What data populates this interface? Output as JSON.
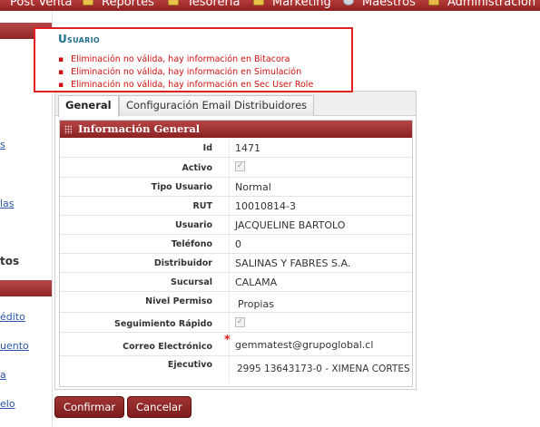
{
  "menu": {
    "items": [
      {
        "label": "Post Venta",
        "icon": "none"
      },
      {
        "label": "Reportes",
        "icon": "folder-icon"
      },
      {
        "label": "Tesorería",
        "icon": "folder-icon"
      },
      {
        "label": "Marketing",
        "icon": "folder-icon"
      },
      {
        "label": "Maestros",
        "icon": "database-icon"
      },
      {
        "label": "Administración",
        "icon": "people-icon"
      }
    ]
  },
  "sidebar": {
    "fragments": [
      "s",
      "las",
      "tos",
      "édito",
      "uento",
      "a",
      "elo"
    ]
  },
  "error_box": {
    "title": "Usuario",
    "messages": [
      "Eliminación no válida, hay información en Bitacora",
      "Eliminación no válida, hay información en Simulación",
      "Eliminación no válida, hay información en Sec User Role"
    ]
  },
  "tabs": [
    {
      "label": "General",
      "active": true
    },
    {
      "label": "Configuración Email Distribuidores",
      "active": false
    }
  ],
  "panel": {
    "title": "Información General",
    "fields": {
      "id": {
        "label": "Id",
        "value": "1471"
      },
      "activo": {
        "label": "Activo",
        "checked": true
      },
      "tipo_usuario": {
        "label": "Tipo Usuario",
        "value": "Normal"
      },
      "rut": {
        "label": "RUT",
        "value": "10010814-3"
      },
      "usuario": {
        "label": "Usuario",
        "value": "JACQUELINE BARTOLO"
      },
      "telefono": {
        "label": "Teléfono",
        "value": "0"
      },
      "distribuidor": {
        "label": "Distribuidor",
        "value": "SALINAS Y FABRES S.A."
      },
      "sucursal": {
        "label": "Sucursal",
        "value": "CALAMA"
      },
      "nivel_permiso": {
        "label": "Nivel Permiso",
        "value": "Propias"
      },
      "seguimiento_rapido": {
        "label": "Seguimiento Rápido",
        "checked": true
      },
      "correo": {
        "label": "Correo Electrónico",
        "value": "gemmatest@grupoglobal.cl",
        "required_mark": "*"
      },
      "ejecutivo": {
        "label": "Ejecutivo",
        "value": "2995   13643173-0 -  XIMENA CORTES"
      }
    }
  },
  "actions": {
    "confirm_label": "Confirmar",
    "cancel_label": "Cancelar"
  },
  "colors": {
    "brand_red": "#8e1f1f",
    "error_red": "#e02020",
    "title_teal": "#1f6e8c",
    "link_blue": "#2a57a5"
  }
}
